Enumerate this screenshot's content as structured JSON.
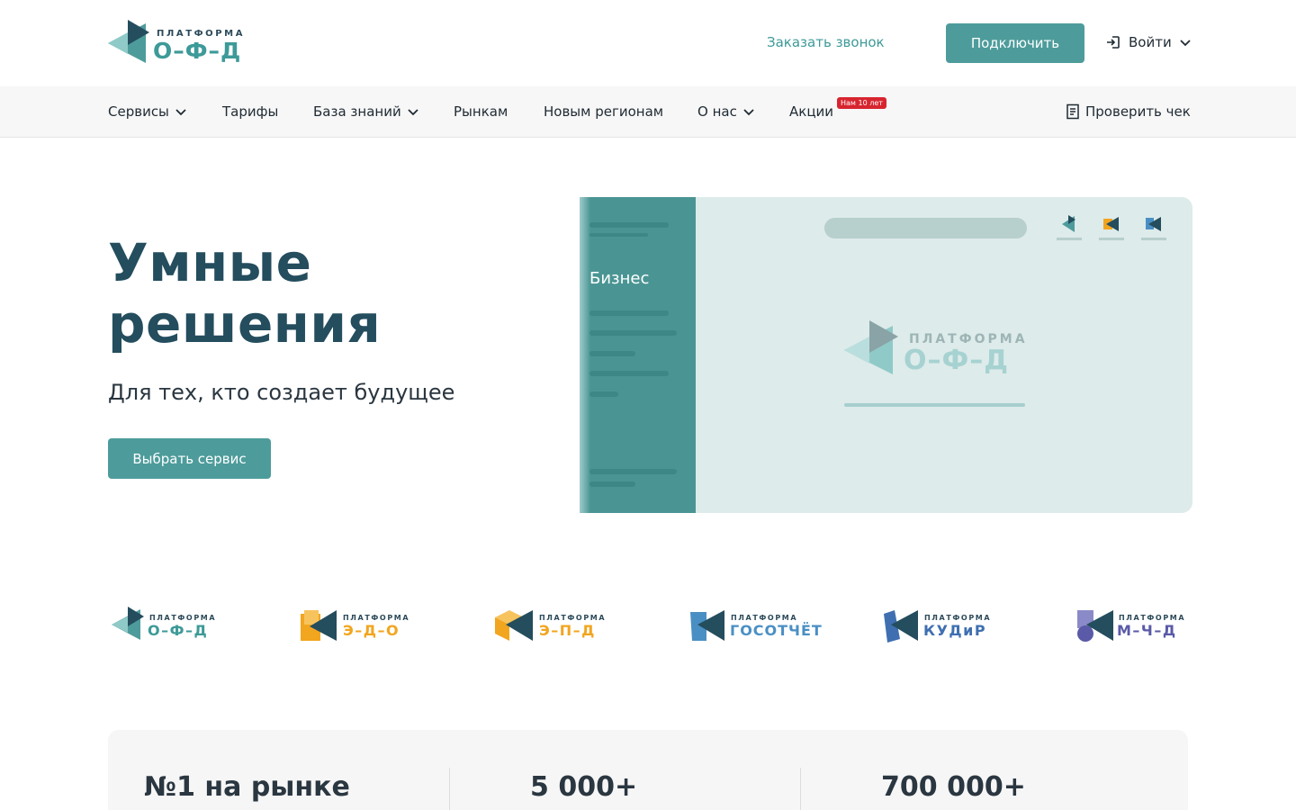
{
  "header": {
    "logo": {
      "top": "ПЛАТФОРМА",
      "main": "О–Ф–Д"
    },
    "callback_label": "Заказать звонок",
    "connect_label": "Подключить",
    "login_label": "Войти"
  },
  "nav": {
    "items": [
      {
        "label": "Сервисы",
        "has_dropdown": true
      },
      {
        "label": "Тарифы",
        "has_dropdown": false
      },
      {
        "label": "База знаний",
        "has_dropdown": true
      },
      {
        "label": "Рынкам",
        "has_dropdown": false
      },
      {
        "label": "Новым регионам",
        "has_dropdown": false
      },
      {
        "label": "О нас",
        "has_dropdown": true
      },
      {
        "label": "Акции",
        "has_dropdown": false
      }
    ],
    "badge": "Нам 10 лет",
    "check_label": "Проверить чек"
  },
  "hero": {
    "title_line1": "Умные",
    "title_line2": "решения",
    "subtitle": "Для тех, кто создает будущее",
    "button_label": "Выбрать сервис",
    "mock": {
      "sidebar_label": "Бизнес",
      "logo_top": "ПЛАТФОРМА",
      "logo_main": "О–Ф–Д"
    }
  },
  "partners": [
    {
      "top": "ПЛАТФОРМА",
      "main": "О–Ф–Д",
      "color": "#3d9a98"
    },
    {
      "top": "ПЛАТФОРМА",
      "main": "Э–Д–О",
      "color": "#f2a51f"
    },
    {
      "top": "ПЛАТФОРМА",
      "main": "Э–П–Д",
      "color": "#f2a51f"
    },
    {
      "top": "ПЛАТФОРМА",
      "main": "ГОСОТЧЁТ",
      "color": "#4a8fc4"
    },
    {
      "top": "ПЛАТФОРМА",
      "main": "КУДиР",
      "color": "#3f6fb0"
    },
    {
      "top": "ПЛАТФОРМА",
      "main": "М–Ч–Д",
      "color": "#5a5aa8"
    }
  ],
  "stats": [
    {
      "value": "№1 на рынке"
    },
    {
      "value": "5 000+"
    },
    {
      "value": "700 000+"
    }
  ],
  "colors": {
    "accent": "#4d9c9b",
    "brand_dark": "#244d5e",
    "badge": "#d7252f"
  }
}
